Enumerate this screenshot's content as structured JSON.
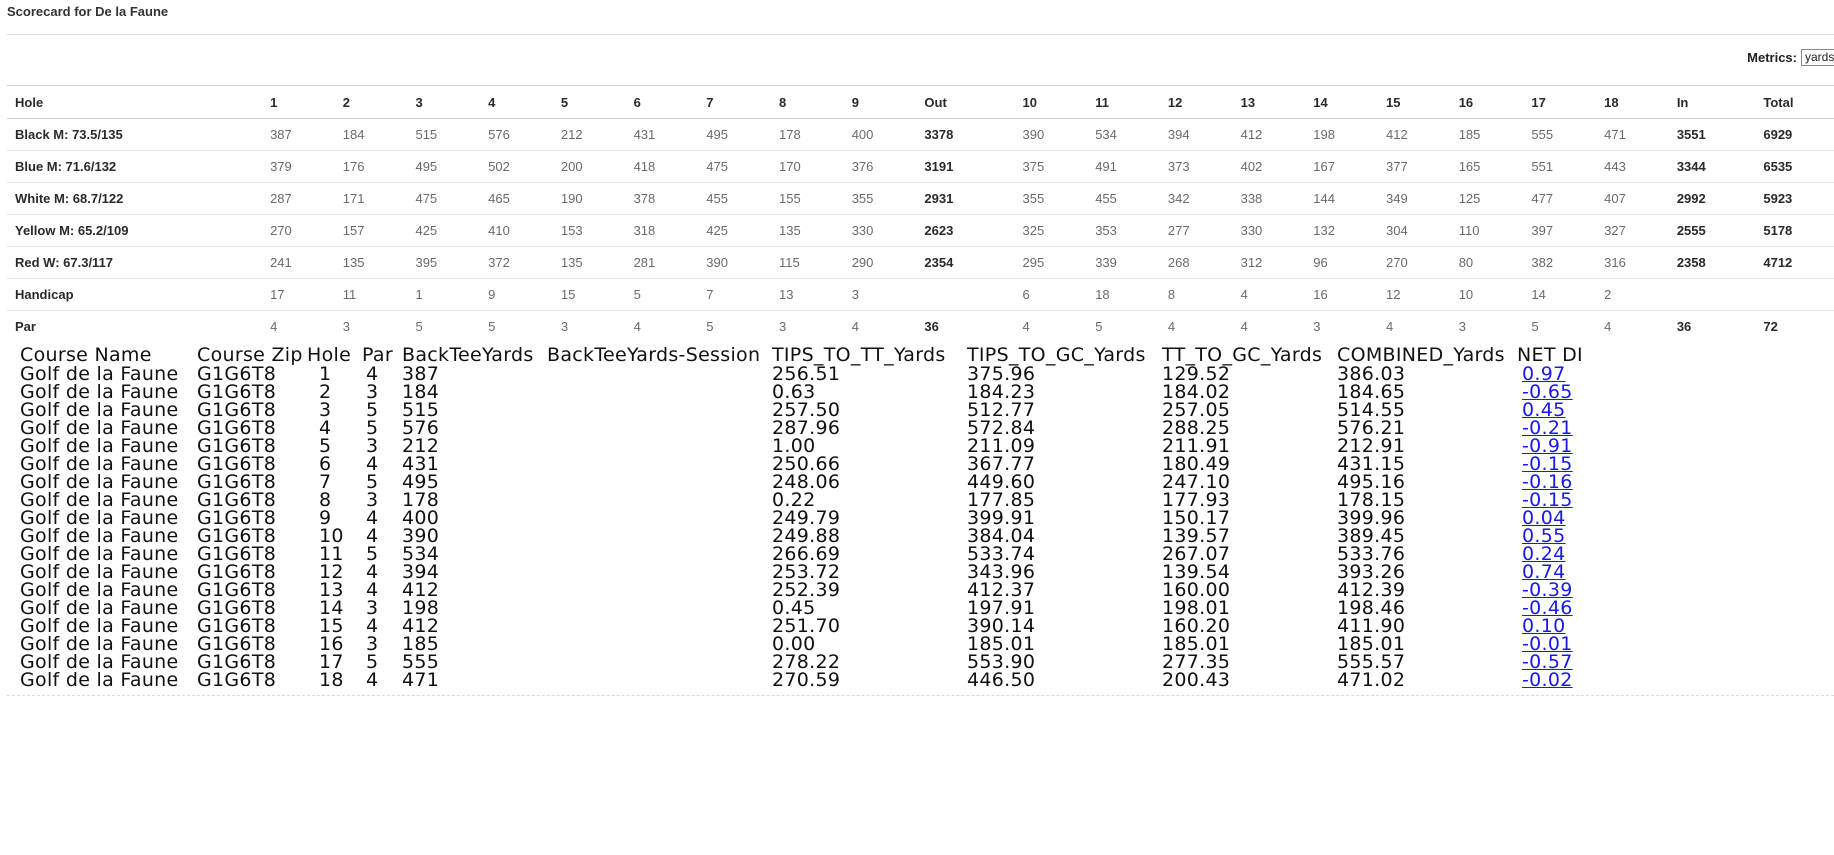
{
  "page": {
    "title": "Scorecard for De la Faune"
  },
  "metrics": {
    "label": "Metrics:",
    "selected": "yards"
  },
  "scorecard": {
    "header": [
      "Hole",
      "1",
      "2",
      "3",
      "4",
      "5",
      "6",
      "7",
      "8",
      "9",
      "Out",
      "10",
      "11",
      "12",
      "13",
      "14",
      "15",
      "16",
      "17",
      "18",
      "In",
      "Total"
    ],
    "rows": [
      {
        "label": "Black M: 73.5/135",
        "values": [
          "387",
          "184",
          "515",
          "576",
          "212",
          "431",
          "495",
          "178",
          "400",
          "3378",
          "390",
          "534",
          "394",
          "412",
          "198",
          "412",
          "185",
          "555",
          "471",
          "3551",
          "6929"
        ]
      },
      {
        "label": "Blue M: 71.6/132",
        "values": [
          "379",
          "176",
          "495",
          "502",
          "200",
          "418",
          "475",
          "170",
          "376",
          "3191",
          "375",
          "491",
          "373",
          "402",
          "167",
          "377",
          "165",
          "551",
          "443",
          "3344",
          "6535"
        ]
      },
      {
        "label": "White M: 68.7/122",
        "values": [
          "287",
          "171",
          "475",
          "465",
          "190",
          "378",
          "455",
          "155",
          "355",
          "2931",
          "355",
          "455",
          "342",
          "338",
          "144",
          "349",
          "125",
          "477",
          "407",
          "2992",
          "5923"
        ]
      },
      {
        "label": "Yellow M: 65.2/109",
        "values": [
          "270",
          "157",
          "425",
          "410",
          "153",
          "318",
          "425",
          "135",
          "330",
          "2623",
          "325",
          "353",
          "277",
          "330",
          "132",
          "304",
          "110",
          "397",
          "327",
          "2555",
          "5178"
        ]
      },
      {
        "label": "Red W: 67.3/117",
        "values": [
          "241",
          "135",
          "395",
          "372",
          "135",
          "281",
          "390",
          "115",
          "290",
          "2354",
          "295",
          "339",
          "268",
          "312",
          "96",
          "270",
          "80",
          "382",
          "316",
          "2358",
          "4712"
        ]
      },
      {
        "label": "Handicap",
        "values": [
          "17",
          "11",
          "1",
          "9",
          "15",
          "5",
          "7",
          "13",
          "3",
          "",
          "6",
          "18",
          "8",
          "4",
          "16",
          "12",
          "10",
          "14",
          "2",
          "",
          ""
        ]
      },
      {
        "label": "Par",
        "values": [
          "4",
          "3",
          "5",
          "5",
          "3",
          "4",
          "5",
          "3",
          "4",
          "36",
          "4",
          "5",
          "4",
          "4",
          "3",
          "4",
          "3",
          "5",
          "4",
          "36",
          "72"
        ]
      }
    ]
  },
  "raw_table": {
    "columns": [
      "Course Name",
      "Course Zip",
      "Hole",
      "Par",
      "BackTeeYards",
      "BackTeeYards-Session",
      "TIPS_TO_TT_Yards",
      "TIPS_TO_GC_Yards",
      "TT_TO_GC_Yards",
      "COMBINED_Yards",
      "NET DI"
    ],
    "rows": [
      {
        "course": "Golf de la Faune",
        "zip": "G1G6T8",
        "hole": "1",
        "par": "4",
        "back": "387",
        "session": "",
        "tips_tt": "256.51",
        "tips_gc": "375.96",
        "tt_gc": "129.52",
        "combined": "386.03",
        "net": "0.97"
      },
      {
        "course": "Golf de la Faune",
        "zip": "G1G6T8",
        "hole": "2",
        "par": "3",
        "back": "184",
        "session": "",
        "tips_tt": "0.63",
        "tips_gc": "184.23",
        "tt_gc": "184.02",
        "combined": "184.65",
        "net": "-0.65"
      },
      {
        "course": "Golf de la Faune",
        "zip": "G1G6T8",
        "hole": "3",
        "par": "5",
        "back": "515",
        "session": "",
        "tips_tt": "257.50",
        "tips_gc": "512.77",
        "tt_gc": "257.05",
        "combined": "514.55",
        "net": "0.45"
      },
      {
        "course": "Golf de la Faune",
        "zip": "G1G6T8",
        "hole": "4",
        "par": "5",
        "back": "576",
        "session": "",
        "tips_tt": "287.96",
        "tips_gc": "572.84",
        "tt_gc": "288.25",
        "combined": "576.21",
        "net": "-0.21"
      },
      {
        "course": "Golf de la Faune",
        "zip": "G1G6T8",
        "hole": "5",
        "par": "3",
        "back": "212",
        "session": "",
        "tips_tt": "1.00",
        "tips_gc": "211.09",
        "tt_gc": "211.91",
        "combined": "212.91",
        "net": "-0.91"
      },
      {
        "course": "Golf de la Faune",
        "zip": "G1G6T8",
        "hole": "6",
        "par": "4",
        "back": "431",
        "session": "",
        "tips_tt": "250.66",
        "tips_gc": "367.77",
        "tt_gc": "180.49",
        "combined": "431.15",
        "net": "-0.15"
      },
      {
        "course": "Golf de la Faune",
        "zip": "G1G6T8",
        "hole": "7",
        "par": "5",
        "back": "495",
        "session": "",
        "tips_tt": "248.06",
        "tips_gc": "449.60",
        "tt_gc": "247.10",
        "combined": "495.16",
        "net": "-0.16"
      },
      {
        "course": "Golf de la Faune",
        "zip": "G1G6T8",
        "hole": "8",
        "par": "3",
        "back": "178",
        "session": "",
        "tips_tt": "0.22",
        "tips_gc": "177.85",
        "tt_gc": "177.93",
        "combined": "178.15",
        "net": "-0.15"
      },
      {
        "course": "Golf de la Faune",
        "zip": "G1G6T8",
        "hole": "9",
        "par": "4",
        "back": "400",
        "session": "",
        "tips_tt": "249.79",
        "tips_gc": "399.91",
        "tt_gc": "150.17",
        "combined": "399.96",
        "net": "0.04"
      },
      {
        "course": "Golf de la Faune",
        "zip": "G1G6T8",
        "hole": "10",
        "par": "4",
        "back": "390",
        "session": "",
        "tips_tt": "249.88",
        "tips_gc": "384.04",
        "tt_gc": "139.57",
        "combined": "389.45",
        "net": "0.55"
      },
      {
        "course": "Golf de la Faune",
        "zip": "G1G6T8",
        "hole": "11",
        "par": "5",
        "back": "534",
        "session": "",
        "tips_tt": "266.69",
        "tips_gc": "533.74",
        "tt_gc": "267.07",
        "combined": "533.76",
        "net": "0.24"
      },
      {
        "course": "Golf de la Faune",
        "zip": "G1G6T8",
        "hole": "12",
        "par": "4",
        "back": "394",
        "session": "",
        "tips_tt": "253.72",
        "tips_gc": "343.96",
        "tt_gc": "139.54",
        "combined": "393.26",
        "net": "0.74"
      },
      {
        "course": "Golf de la Faune",
        "zip": "G1G6T8",
        "hole": "13",
        "par": "4",
        "back": "412",
        "session": "",
        "tips_tt": "252.39",
        "tips_gc": "412.37",
        "tt_gc": "160.00",
        "combined": "412.39",
        "net": "-0.39"
      },
      {
        "course": "Golf de la Faune",
        "zip": "G1G6T8",
        "hole": "14",
        "par": "3",
        "back": "198",
        "session": "",
        "tips_tt": "0.45",
        "tips_gc": "197.91",
        "tt_gc": "198.01",
        "combined": "198.46",
        "net": "-0.46"
      },
      {
        "course": "Golf de la Faune",
        "zip": "G1G6T8",
        "hole": "15",
        "par": "4",
        "back": "412",
        "session": "",
        "tips_tt": "251.70",
        "tips_gc": "390.14",
        "tt_gc": "160.20",
        "combined": "411.90",
        "net": "0.10"
      },
      {
        "course": "Golf de la Faune",
        "zip": "G1G6T8",
        "hole": "16",
        "par": "3",
        "back": "185",
        "session": "",
        "tips_tt": "0.00",
        "tips_gc": "185.01",
        "tt_gc": "185.01",
        "combined": "185.01",
        "net": "-0.01"
      },
      {
        "course": "Golf de la Faune",
        "zip": "G1G6T8",
        "hole": "17",
        "par": "5",
        "back": "555",
        "session": "",
        "tips_tt": "278.22",
        "tips_gc": "553.90",
        "tt_gc": "277.35",
        "combined": "555.57",
        "net": "-0.57"
      },
      {
        "course": "Golf de la Faune",
        "zip": "G1G6T8",
        "hole": "18",
        "par": "4",
        "back": "471",
        "session": "",
        "tips_tt": "270.59",
        "tips_gc": "446.50",
        "tt_gc": "200.43",
        "combined": "471.02",
        "net": "-0.02"
      }
    ]
  }
}
